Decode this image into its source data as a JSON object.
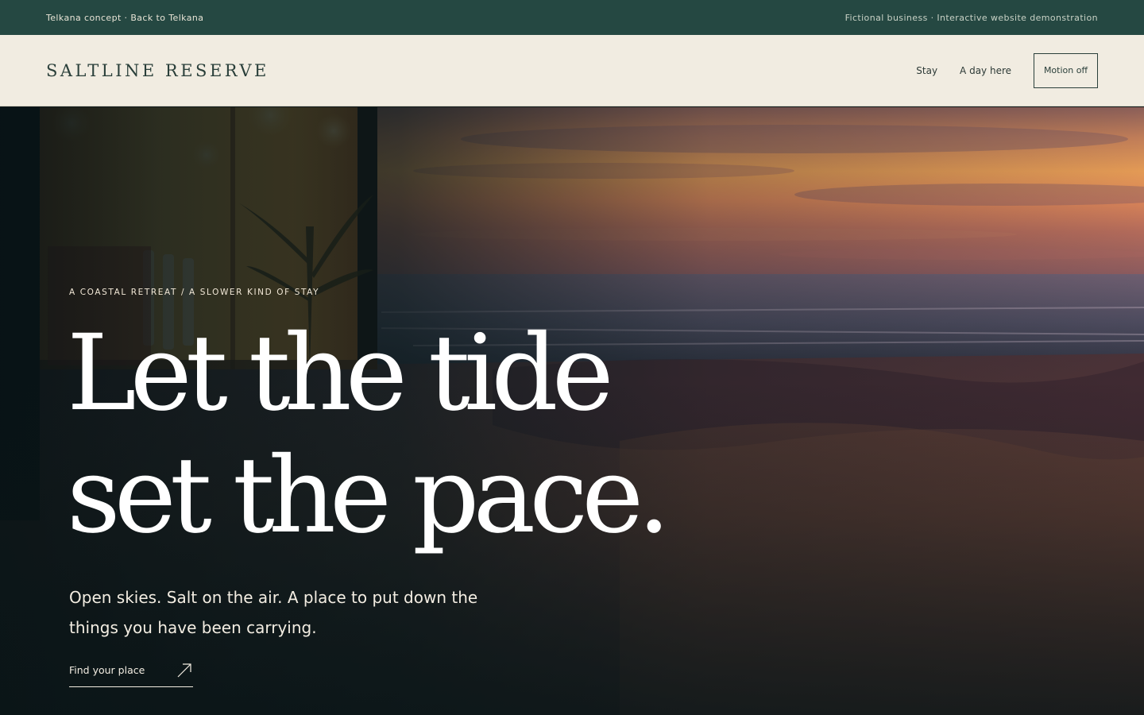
{
  "topbar": {
    "left_text": "Telkana concept · Back to Telkana",
    "right_text": "Fictional business · Interactive website demonstration"
  },
  "header": {
    "brand": "SALTLINE RESERVE",
    "nav": [
      {
        "label": "Stay"
      },
      {
        "label": "A day here"
      }
    ],
    "motion_button": "Motion off"
  },
  "hero": {
    "eyebrow": "A COASTAL RETREAT / A SLOWER KIND OF STAY",
    "headline_line1": "Let the tide",
    "headline_line2": "set the pace.",
    "subcopy": "Open skies. Salt on the air. A place to put down the things you have been carrying.",
    "cta_label": "Find your place",
    "cta_icon": "arrow-up-right-icon"
  },
  "colors": {
    "topbar_bg": "#254842",
    "header_bg": "#f1ece1",
    "brand_text": "#2a3f3a",
    "hero_text": "#ffffff"
  }
}
